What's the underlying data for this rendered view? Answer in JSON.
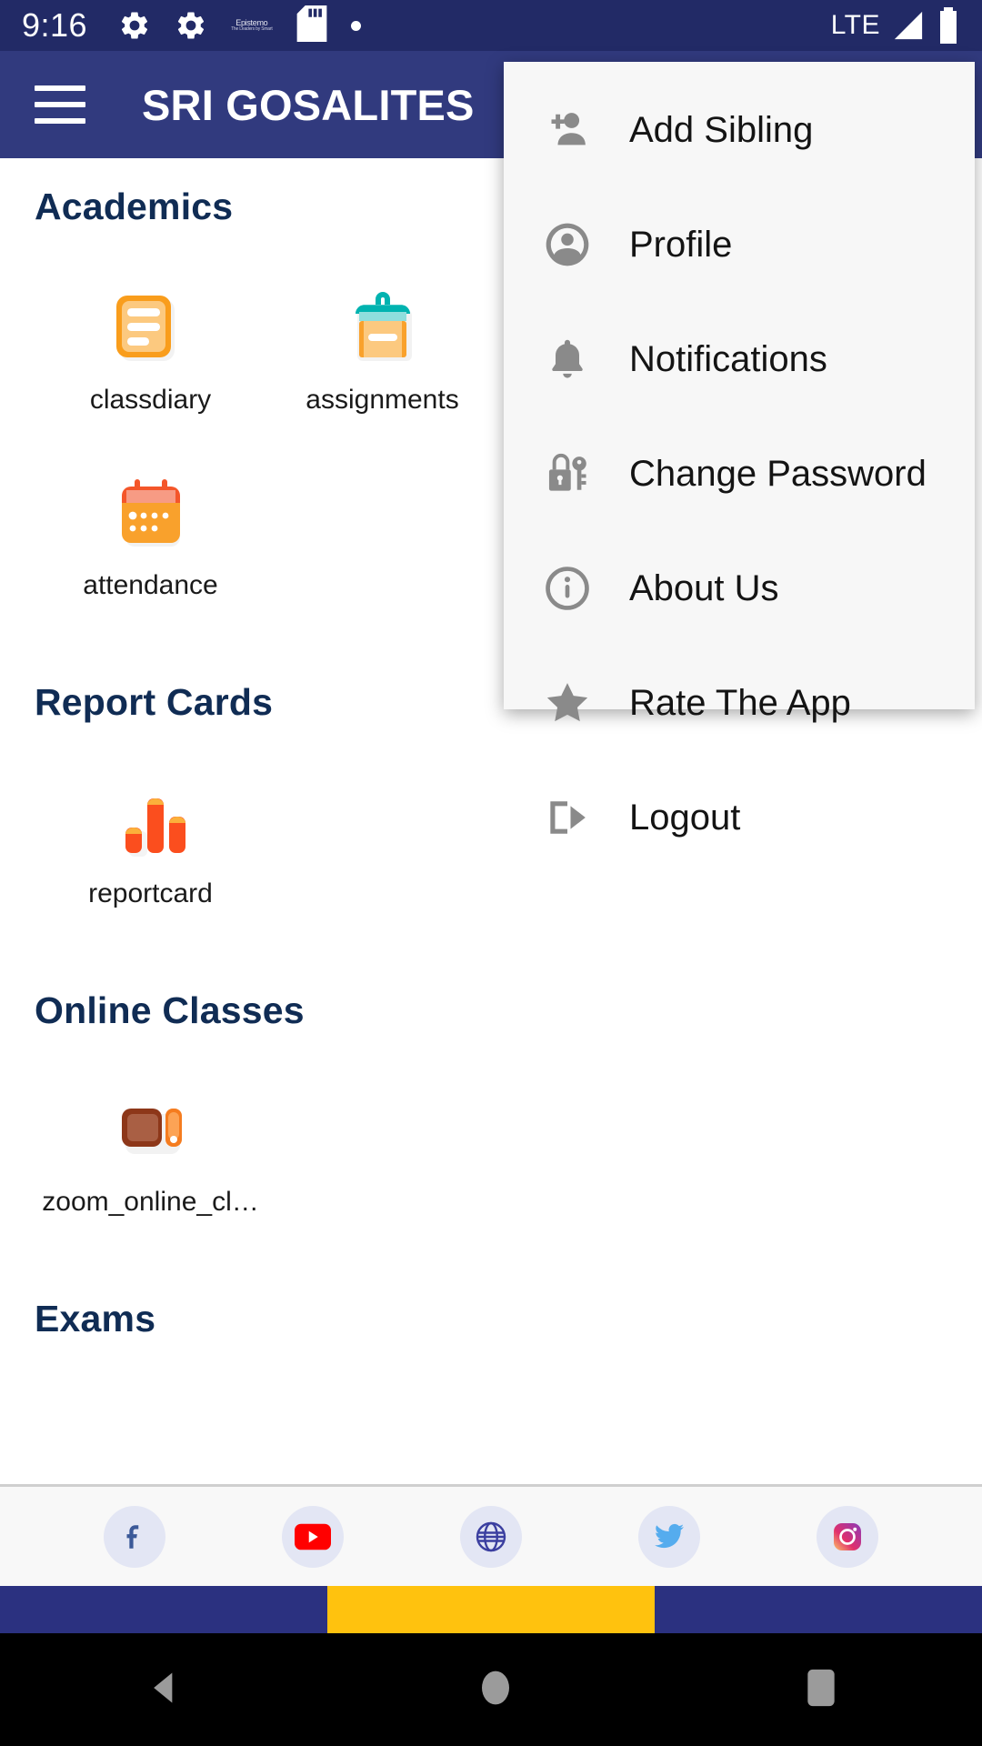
{
  "status_bar": {
    "time": "9:16",
    "carrier": "LTE",
    "icons": [
      "gear-icon",
      "gear-icon",
      "epistemo-logo-icon",
      "sd-card-icon",
      "dot-icon",
      "signal-icon",
      "battery-icon"
    ],
    "epistemo": {
      "line1": "Epistemo",
      "line2": "The Leaders by Smart"
    },
    "background": "#222a66"
  },
  "app_bar": {
    "menu_icon": "hamburger-icon",
    "title": "SRI GOSALITES",
    "background": "#313a7e"
  },
  "overflow_menu": {
    "background": "#f7f7f7",
    "items": [
      {
        "label": "Add Sibling",
        "icon": "add-person-icon"
      },
      {
        "label": "Profile",
        "icon": "account-circle-icon"
      },
      {
        "label": "Notifications",
        "icon": "bell-icon"
      },
      {
        "label": "Change Password",
        "icon": "lock-key-icon"
      },
      {
        "label": "About Us",
        "icon": "info-circle-icon"
      },
      {
        "label": "Rate The App",
        "icon": "star-icon"
      },
      {
        "label": "Logout",
        "icon": "logout-icon"
      }
    ]
  },
  "main": {
    "heading_color": "#102c54",
    "sections": [
      {
        "title": "Academics",
        "tiles": [
          {
            "label": "classdiary",
            "icon": "notes-document-icon"
          },
          {
            "label": "assignments",
            "icon": "clipboard-icon"
          },
          {
            "label": "attendance",
            "icon": "calendar-icon"
          }
        ]
      },
      {
        "title": "Report Cards",
        "tiles": [
          {
            "label": "reportcard",
            "icon": "bar-chart-icon"
          }
        ]
      },
      {
        "title": "Online Classes",
        "tiles": [
          {
            "label": "zoom_online_cl…",
            "icon": "zoom-video-icon"
          }
        ]
      },
      {
        "title": "Exams",
        "tiles": []
      }
    ]
  },
  "social_bar": {
    "items": [
      {
        "name": "facebook-icon",
        "color": "#3b5998"
      },
      {
        "name": "youtube-icon",
        "color": "#ff0000"
      },
      {
        "name": "website-globe-icon",
        "color": "#3b3fa0"
      },
      {
        "name": "twitter-icon",
        "color": "#55acee"
      },
      {
        "name": "instagram-icon",
        "color": "#e1306c"
      }
    ]
  },
  "brand_strip": {
    "colors": [
      "#2b3180",
      "#ffc20e",
      "#2b3180"
    ]
  },
  "android_nav": {
    "items": [
      {
        "name": "back-button",
        "glyph": "triangle-left"
      },
      {
        "name": "home-button",
        "glyph": "circle"
      },
      {
        "name": "recents-button",
        "glyph": "square"
      }
    ]
  }
}
